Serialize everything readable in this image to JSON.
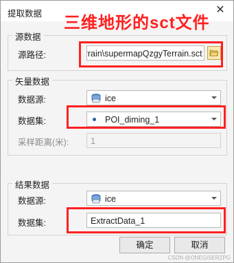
{
  "window": {
    "title": "提取数据",
    "close_glyph": "✕"
  },
  "annotation": {
    "text": "三维地形的sct文件",
    "color": "#ff2020"
  },
  "source_group": {
    "title": "源数据",
    "path_label": "源路径:",
    "path_value": "/Terrain\\supermapQzgyTerrain.sct",
    "browse_icon": "folder-open-icon"
  },
  "vector_group": {
    "title": "矢量数据",
    "datasource_label": "数据源:",
    "datasource_value": "ice",
    "dataset_label": "数据集:",
    "dataset_value": "POI_diming_1",
    "sample_label": "采样距离(米):",
    "sample_value": "1"
  },
  "result_group": {
    "title": "结果数据",
    "datasource_label": "数据源:",
    "datasource_value": "ice",
    "dataset_label": "数据集:",
    "dataset_value": "ExtractData_1"
  },
  "buttons": {
    "ok": "确定",
    "cancel": "取消"
  },
  "watermark": "CSDN @ONEGISERZPG",
  "colors": {
    "highlight": "#ff2020",
    "folder": "#f9e9b3",
    "dataset_bullet": "#2b5ea8"
  }
}
